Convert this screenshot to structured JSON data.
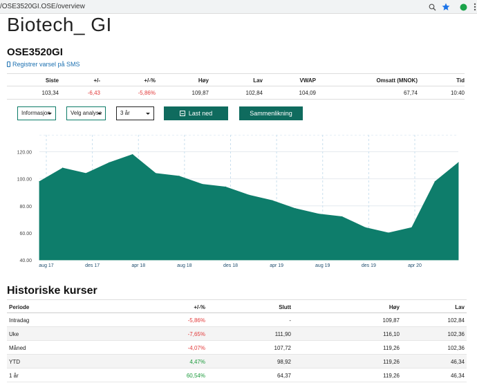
{
  "browser": {
    "url": "/OSE3520GI.OSE/overview",
    "accent": "#1a73e8"
  },
  "page": {
    "title": "Biotech_ GI",
    "ticker": "OSE3520GI",
    "sms_link": "Registrer varsel på SMS"
  },
  "quote": {
    "headers": [
      "Siste",
      "+/-",
      "+/-%",
      "Høy",
      "Lav",
      "VWAP",
      "Omsatt (MNOK)",
      "Tid"
    ],
    "values": [
      "103,34",
      "-6,43",
      "-5,86%",
      "109,87",
      "102,84",
      "104,09",
      "67,74",
      "10:40"
    ]
  },
  "controls": {
    "info_label": "Informasjon",
    "analysis_label": "Velg analyse",
    "period_label": "3 år",
    "download_label": "Last ned",
    "compare_label": "Sammenlikning"
  },
  "colors": {
    "brand": "#0f6b5e",
    "chart_fill": "#0e7d6b",
    "negative": "#e23a3a",
    "positive": "#1a9a3a"
  },
  "chart_data": {
    "type": "area",
    "x_ticks": [
      "aug 17",
      "des 17",
      "apr 18",
      "aug 18",
      "des 18",
      "apr 19",
      "aug 19",
      "des 19",
      "apr 20"
    ],
    "y_ticks": [
      "40.00",
      "60.00",
      "80.00",
      "100.00",
      "120.00"
    ],
    "ylim": [
      40,
      130
    ],
    "grid": true,
    "x": [
      0,
      2,
      4,
      6,
      8,
      10,
      12,
      14,
      16,
      18,
      20,
      22,
      24,
      26,
      28,
      30,
      32,
      34,
      36
    ],
    "values": [
      98,
      108,
      104,
      112,
      118,
      104,
      102,
      96,
      94,
      88,
      84,
      78,
      74,
      72,
      64,
      60,
      64,
      98,
      112
    ]
  },
  "history": {
    "title": "Historiske kurser",
    "headers": [
      "Periode",
      "+/-%",
      "Slutt",
      "Høy",
      "Lav"
    ],
    "rows": [
      {
        "period": "Intradag",
        "pct": "-5,86%",
        "close": "-",
        "high": "109,87",
        "low": "102,84",
        "sign": "neg"
      },
      {
        "period": "Uke",
        "pct": "-7,65%",
        "close": "111,90",
        "high": "116,10",
        "low": "102,36",
        "sign": "neg"
      },
      {
        "period": "Måned",
        "pct": "-4,07%",
        "close": "107,72",
        "high": "119,26",
        "low": "102,36",
        "sign": "neg"
      },
      {
        "period": "YTD",
        "pct": "4,47%",
        "close": "98,92",
        "high": "119,26",
        "low": "46,34",
        "sign": "pos"
      },
      {
        "period": "1 år",
        "pct": "60,54%",
        "close": "64,37",
        "high": "119,26",
        "low": "46,34",
        "sign": "pos"
      }
    ]
  }
}
